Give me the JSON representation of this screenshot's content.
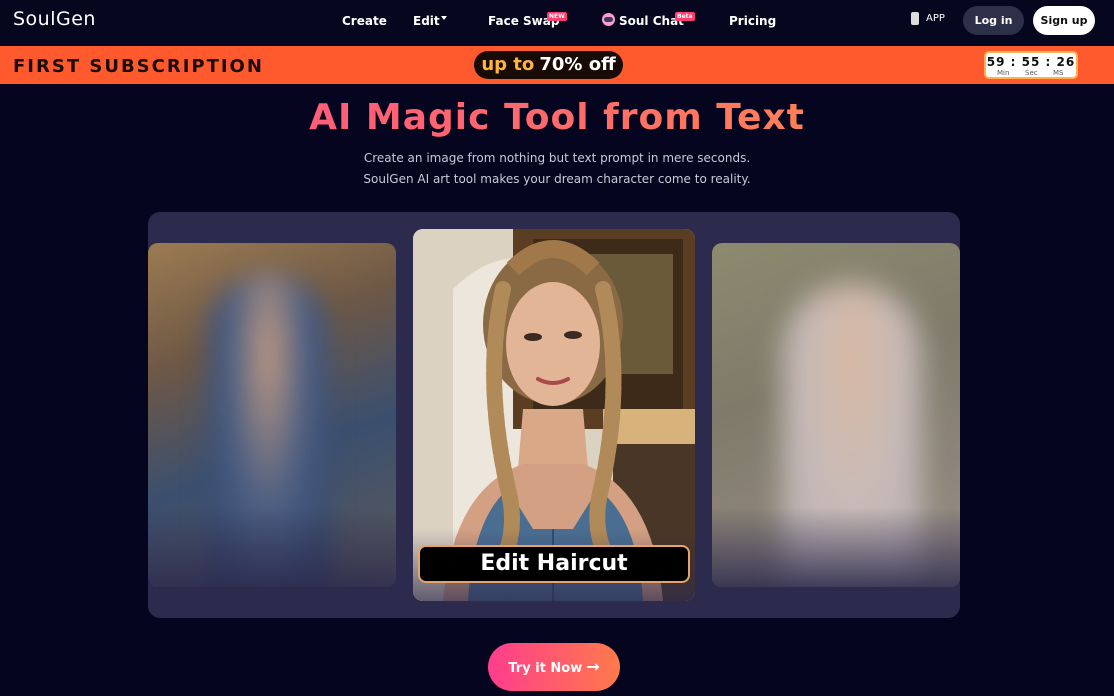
{
  "nav": {
    "logo": "SoulGen",
    "items": [
      {
        "label": "Create"
      },
      {
        "label": "Edit"
      },
      {
        "label": "Face Swap",
        "badge": "NEW"
      },
      {
        "label": "Soul Chat",
        "badge": "Beta"
      },
      {
        "label": "Pricing"
      }
    ],
    "app_label": "APP",
    "login": "Log in",
    "signup": "Sign up"
  },
  "promo": {
    "title": "FIRST SUBSCRIPTION",
    "offer_prefix": "up to",
    "offer_value": "70% off",
    "timer": {
      "min": "59",
      "sec": "55",
      "ms": "26",
      "labels": [
        "Min",
        "Sec",
        "MS"
      ]
    }
  },
  "hero": {
    "title": "AI Magic Tool from Text",
    "subtitle_1": "Create an image from nothing but text prompt in mere seconds.",
    "subtitle_2": "SoulGen AI art tool makes your dream character come to reality."
  },
  "showcase": {
    "label": "Edit Haircut"
  },
  "cta": {
    "label": "Try it Now"
  },
  "colors": {
    "background": "#05051f",
    "promo": "#ff5a2e",
    "accent_pink": "#ff3d8e",
    "accent_orange": "#ff7a4a"
  }
}
